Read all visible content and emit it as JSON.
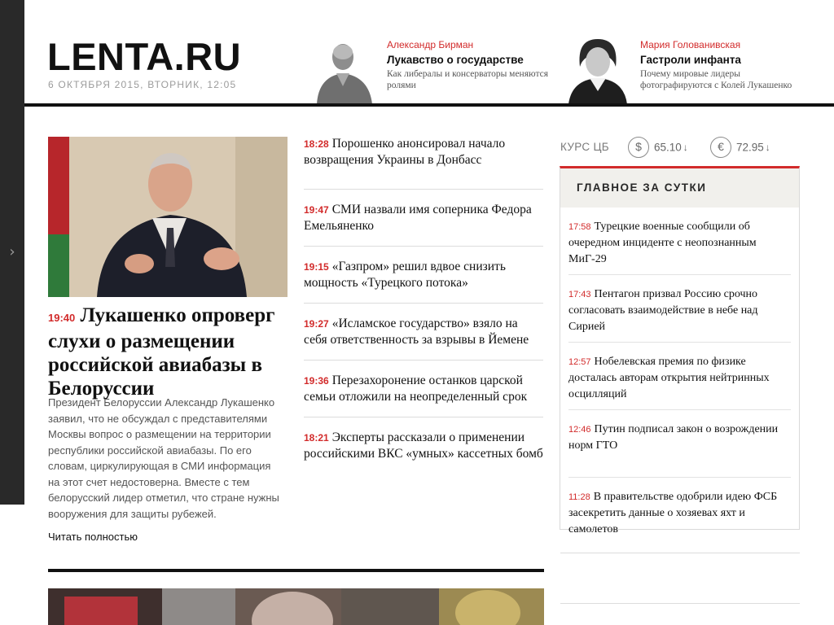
{
  "header": {
    "logo": "LENTA.RU",
    "date": "6 ОКТЯБРЯ 2015, ВТОРНИК, 12:05"
  },
  "columnists": [
    {
      "author": "Александр Бирман",
      "title": "Лукавство о государстве",
      "subtitle": "Как либералы и консерваторы меняются ролями"
    },
    {
      "author": "Мария Голованивская",
      "title": "Гастроли инфанта",
      "subtitle": "Почему мировые лидеры фотографируются с Колей Лукашенко"
    }
  ],
  "lead": {
    "time": "19:40",
    "title": "Лукашенко опроверг слухи о размещении российской авиабазы в Белоруссии",
    "text": "Президент Белоруссии Александр Лукашенко заявил, что не обсуждал с представителями Москвы вопрос о размещении на территории республики российской авиабазы. По его словам, циркулирующая в СМИ информация на этот счет недостоверна. Вместе с тем белорусский лидер отметил, что стране нужны вооружения для защиты рубежей.",
    "read_more": "Читать полностью"
  },
  "news": [
    {
      "time": "18:28",
      "title": "Порошенко анонсировал начало возвращения Украины в Донбасс"
    },
    {
      "time": "19:47",
      "title": "СМИ назвали имя соперника Федора Емельяненко"
    },
    {
      "time": "19:15",
      "title": "«Газпром» решил вдвое снизить мощность «Турецкого потока»"
    },
    {
      "time": "19:27",
      "title": "«Исламское государство» взяло на себя ответственность за взрывы в Йемене"
    },
    {
      "time": "19:36",
      "title": "Перезахоронение останков царской семьи отложили на неопределенный срок"
    },
    {
      "time": "18:21",
      "title": "Эксперты рассказали о применении российскими ВКС «умных» кассетных бомб"
    }
  ],
  "rates": {
    "label": "КУРС ЦБ",
    "usd_symbol": "$",
    "usd_value": "65.10",
    "usd_dir": "↓",
    "eur_symbol": "€",
    "eur_value": "72.95",
    "eur_dir": "↓"
  },
  "main_day": {
    "heading": "ГЛАВНОЕ ЗА СУТКИ",
    "items": [
      {
        "time": "17:58",
        "title": "Турецкие военные сообщили об очередном инциденте с неопознанным МиГ-29"
      },
      {
        "time": "17:43",
        "title": "Пентагон призвал Россию срочно согласовать взаимодействие в небе над Сирией"
      },
      {
        "time": "12:57",
        "title": "Нобелевская премия по физике досталась авторам открытия нейтринных осцилляций"
      },
      {
        "time": "12:46",
        "title": "Путин подписал закон о возрождении норм ГТО"
      },
      {
        "time": "11:28",
        "title": "В правительстве одобрили идею ФСБ засекретить данные о хозяевах яхт и самолетов"
      }
    ]
  },
  "colors": {
    "accent": "#d22b2b",
    "text": "#111111",
    "rail": "#292929"
  }
}
